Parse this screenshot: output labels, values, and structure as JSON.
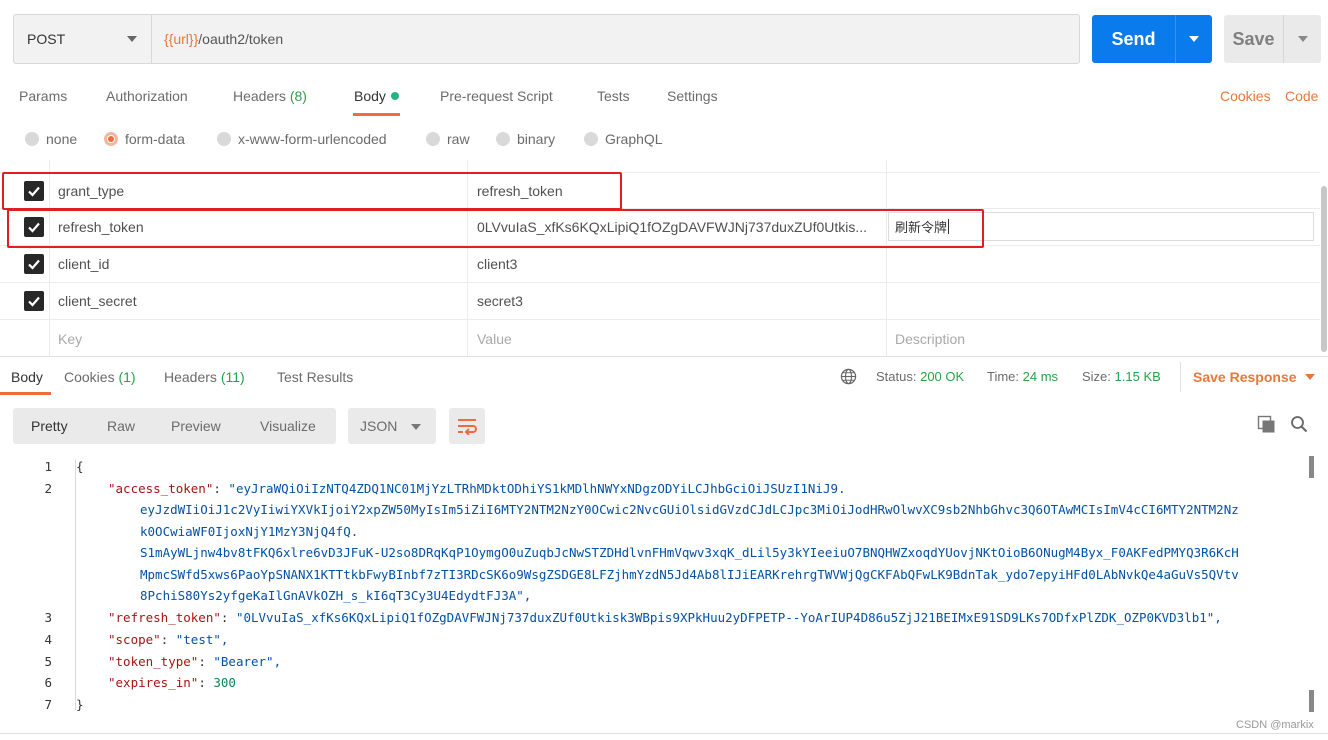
{
  "request": {
    "method": "POST",
    "url_var": "{{url}}",
    "url_path": "/oauth2/token",
    "send_label": "Send",
    "save_label": "Save"
  },
  "tabs": {
    "params": "Params",
    "authorization": "Authorization",
    "headers": "Headers",
    "headers_count": "(8)",
    "body": "Body",
    "prerequest": "Pre-request Script",
    "tests": "Tests",
    "settings": "Settings",
    "cookies": "Cookies",
    "code": "Code"
  },
  "body_types": [
    "none",
    "form-data",
    "x-www-form-urlencoded",
    "raw",
    "binary",
    "GraphQL"
  ],
  "body_type_selected": "form-data",
  "params": [
    {
      "checked": true,
      "key": "grant_type",
      "value": "refresh_token",
      "description": ""
    },
    {
      "checked": true,
      "key": "refresh_token",
      "value": "0LVvuIaS_xfKs6KQxLipiQ1fOZgDAVFWJNj737duxZUf0Utkis...",
      "description": "刷新令牌"
    },
    {
      "checked": true,
      "key": "client_id",
      "value": "client3",
      "description": ""
    },
    {
      "checked": true,
      "key": "client_secret",
      "value": "secret3",
      "description": ""
    }
  ],
  "params_placeholder": {
    "key": "Key",
    "value": "Value",
    "description": "Description"
  },
  "response": {
    "tabs": {
      "body": "Body",
      "cookies": "Cookies",
      "cookies_count": "(1)",
      "headers": "Headers",
      "headers_count": "(11)",
      "test_results": "Test Results"
    },
    "status_label": "Status:",
    "status_value": "200 OK",
    "time_label": "Time:",
    "time_value": "24 ms",
    "size_label": "Size:",
    "size_value": "1.15 KB",
    "save_response": "Save Response",
    "views": [
      "Pretty",
      "Raw",
      "Preview",
      "Visualize"
    ],
    "format": "JSON",
    "line_numbers": [
      "1",
      "2",
      "3",
      "4",
      "5",
      "6",
      "7"
    ],
    "json": {
      "open_brace": "{",
      "close_brace": "}",
      "access_token_key": "\"access_token\"",
      "access_token_lines": [
        "\"eyJraWQiOiIzNTQ4ZDQ1NC01MjYzLTRhMDktODhiYS1kMDlhNWYxNDgzODYiLCJhbGciOiJSUzI1NiJ9.",
        "eyJzdWIiOiJ1c2VyIiwiYXVkIjoiY2xpZW50MyIsIm5iZiI6MTY2NTM2NzY0OCwic2NvcGUiOlsidGVzdCJdLCJpc3MiOiJodHRwOlwvXC9sb2NhbGhvc3Q6OTAwMCIsImV4cCI6MTY2NTM2Nz",
        "k0OCwiaWF0IjoxNjY1MzY3NjQ4fQ.",
        "S1mAyWLjnw4bv8tFKQ6xlre6vD3JFuK-U2so8DRqKqP1OymgO0uZuqbJcNwSTZDHdlvnFHmVqwv3xqK_dLil5y3kYIeeiuO7BNQHWZxoqdYUovjNKtOioB6ONugM4Byx_F0AKFedPMYQ3R6KcH",
        "MpmcSWfd5xws6PaoYpSNANX1KTTtkbFwyBInbf7zTI3RDcSK6o9WsgZSDGE8LFZjhmYzdN5Jd4Ab8lIJiEARKrehrgTWVWjQgCKFAbQFwLK9BdnTak_ydo7epyiHFd0LAbNvkQe4aGuVs5QVtv",
        "8PchiS80Ys2yfgeKaIlGnAVkOZH_s_kI6qT3Cy3U4EdydtFJ3A\","
      ],
      "refresh_token_key": "\"refresh_token\"",
      "refresh_token_value": "\"0LVvuIaS_xfKs6KQxLipiQ1fOZgDAVFWJNj737duxZUf0Utkisk3WBpis9XPkHuu2yDFPETP--YoArIUP4D86u5ZjJ21BEIMxE91SD9LKs7ODfxPlZDK_OZP0KVD3lb1\",",
      "scope_key": "\"scope\"",
      "scope_value": "\"test\",",
      "token_type_key": "\"token_type\"",
      "token_type_value": "\"Bearer\",",
      "expires_in_key": "\"expires_in\"",
      "expires_in_value": "300"
    }
  },
  "watermark": "CSDN @markix",
  "colors": {
    "send": "#097bed",
    "accent": "#f26b3a",
    "success": "#2ca04a",
    "highlight": "#e02020"
  }
}
